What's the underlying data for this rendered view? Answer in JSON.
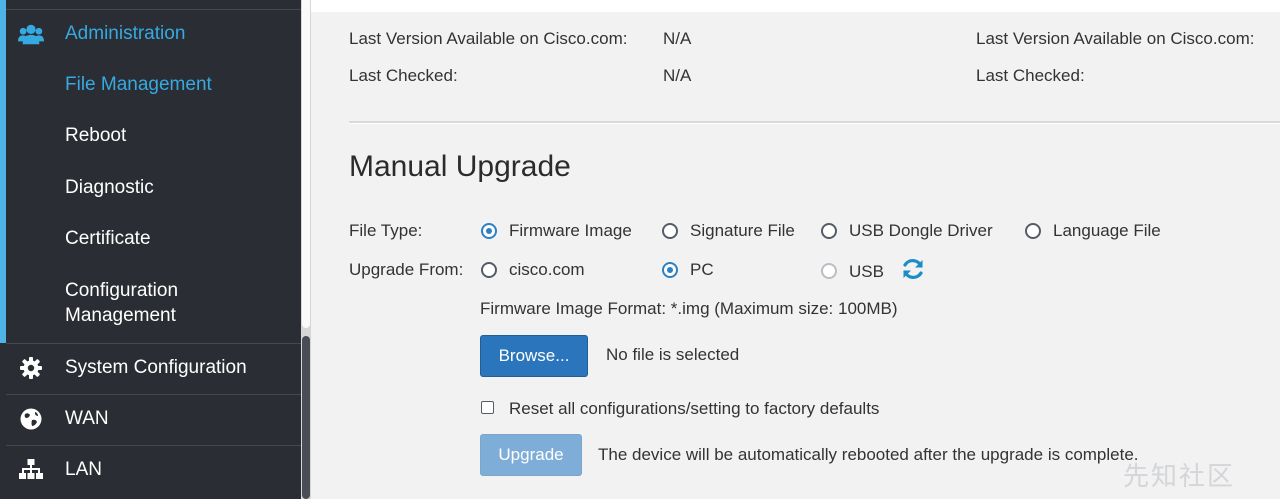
{
  "sidebar": {
    "items": [
      {
        "label": "Administration",
        "icon": "users-icon",
        "active": true
      },
      {
        "label": "File Management",
        "active": true
      },
      {
        "label": "Reboot"
      },
      {
        "label": "Diagnostic"
      },
      {
        "label": "Certificate"
      },
      {
        "label": "Configuration\nManagement"
      },
      {
        "label": "System Configuration",
        "icon": "gear-icon"
      },
      {
        "label": "WAN",
        "icon": "globe-icon"
      },
      {
        "label": "LAN",
        "icon": "network-icon"
      }
    ]
  },
  "status": {
    "left": {
      "last_version_label": "Last Version Available on Cisco.com:",
      "last_version_value": "N/A",
      "last_checked_label": "Last Checked:",
      "last_checked_value": "N/A"
    },
    "right": {
      "last_version_label": "Last Version Available on Cisco.com:",
      "last_checked_label": "Last Checked:"
    }
  },
  "manual_upgrade": {
    "title": "Manual Upgrade",
    "file_type_label": "File Type:",
    "file_types": [
      "Firmware Image",
      "Signature File",
      "USB Dongle Driver",
      "Language File"
    ],
    "file_type_selected": "Firmware Image",
    "upgrade_from_label": "Upgrade From:",
    "upgrade_from_options": [
      "cisco.com",
      "PC",
      "USB"
    ],
    "upgrade_from_selected": "PC",
    "format_note": "Firmware Image Format: *.img (Maximum size: 100MB)",
    "browse_label": "Browse...",
    "file_status": "No file is selected",
    "reset_label": "Reset all configurations/setting to factory defaults",
    "reset_checked": false,
    "upgrade_label": "Upgrade",
    "upgrade_note": "The device will be automatically rebooted after the upgrade is complete."
  },
  "watermark": "先知社区",
  "colors": {
    "accent": "#36a9e1",
    "primary_button": "#2a75bb",
    "sidebar_bg": "#2a2d33"
  }
}
